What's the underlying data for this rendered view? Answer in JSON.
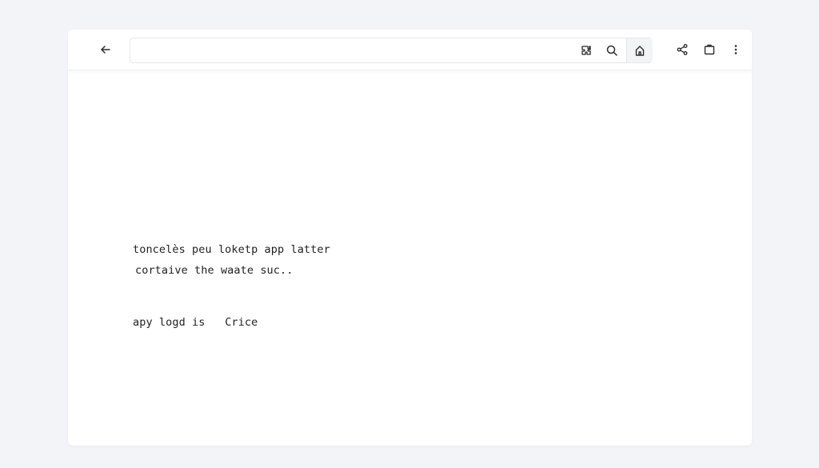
{
  "toolbar": {
    "back_icon": "arrow-left-icon",
    "address": {
      "value": "",
      "placeholder": ""
    },
    "address_icons": [
      "puzzle-icon",
      "search-icon",
      "home-icon"
    ],
    "right_icons": [
      "share-icon",
      "tabs-icon",
      "more-vertical-icon"
    ]
  },
  "content": {
    "line1": "toncelès peu loketp app latter",
    "line2": "cortaive the waate suc..",
    "line3_text": "apy logd is",
    "line3_link": "Crice"
  }
}
